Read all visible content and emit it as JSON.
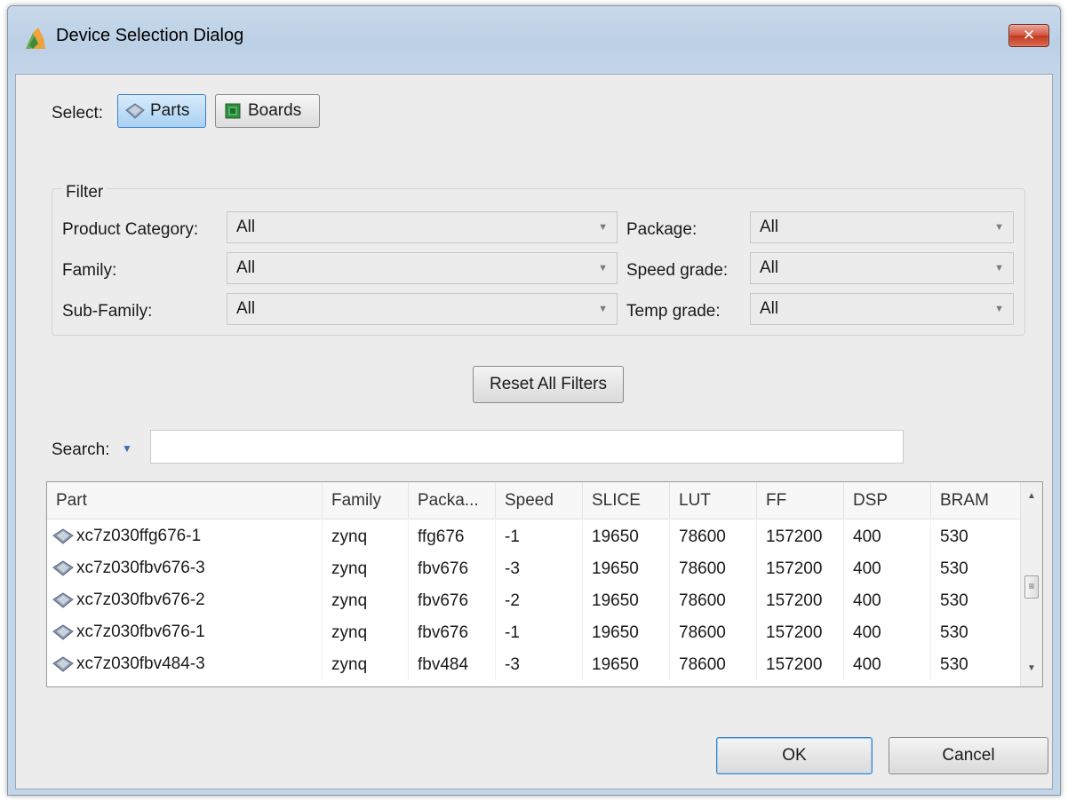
{
  "window": {
    "title": "Device Selection Dialog",
    "close_glyph": "✕"
  },
  "select": {
    "label": "Select:",
    "options": [
      {
        "label": "Parts",
        "active": true,
        "icon": "part-chip-icon"
      },
      {
        "label": "Boards",
        "active": false,
        "icon": "board-icon"
      }
    ]
  },
  "filter": {
    "legend": "Filter",
    "fields": [
      {
        "label": "Product Category:",
        "value": "All"
      },
      {
        "label": "Family:",
        "value": "All"
      },
      {
        "label": "Sub-Family:",
        "value": "All"
      },
      {
        "label": "Package:",
        "value": "All"
      },
      {
        "label": "Speed grade:",
        "value": "All"
      },
      {
        "label": "Temp grade:",
        "value": "All"
      }
    ],
    "reset_label": "Reset All Filters"
  },
  "search": {
    "label": "Search:",
    "value": ""
  },
  "table": {
    "columns": [
      "Part",
      "Family",
      "Packa...",
      "Speed",
      "SLICE",
      "LUT",
      "FF",
      "DSP",
      "BRAM"
    ],
    "rows": [
      [
        "xc7z030ffg676-1",
        "zynq",
        "ffg676",
        "-1",
        "19650",
        "78600",
        "157200",
        "400",
        "530"
      ],
      [
        "xc7z030fbv676-3",
        "zynq",
        "fbv676",
        "-3",
        "19650",
        "78600",
        "157200",
        "400",
        "530"
      ],
      [
        "xc7z030fbv676-2",
        "zynq",
        "fbv676",
        "-2",
        "19650",
        "78600",
        "157200",
        "400",
        "530"
      ],
      [
        "xc7z030fbv676-1",
        "zynq",
        "fbv676",
        "-1",
        "19650",
        "78600",
        "157200",
        "400",
        "530"
      ],
      [
        "xc7z030fbv484-3",
        "zynq",
        "fbv484",
        "-3",
        "19650",
        "78600",
        "157200",
        "400",
        "530"
      ]
    ]
  },
  "buttons": {
    "ok": "OK",
    "cancel": "Cancel"
  },
  "colors": {
    "accent": "#3b80c8",
    "close": "#c0391f",
    "client_bg": "#ececec"
  }
}
